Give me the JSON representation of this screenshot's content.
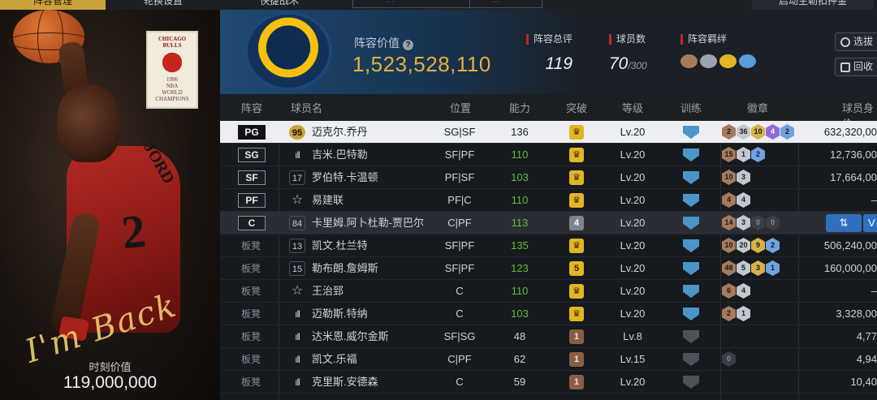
{
  "tabs": [
    {
      "label": "阵容管理",
      "active": true
    },
    {
      "label": "轮换设置"
    },
    {
      "label": "快捷战术"
    }
  ],
  "top_input": {
    "left": "…",
    "right": "…"
  },
  "top_right_button": "启动主勒扣押金",
  "card": {
    "badge_lines": [
      "CHICAGO",
      "BULLS",
      "1996",
      "NBA",
      "WORLD",
      "CHAMPIONS"
    ],
    "jersey_text": "JORD",
    "jersey_number": "2",
    "signature": "I'm Back",
    "value_label": "时刻价值",
    "value": "119,000,000"
  },
  "header": {
    "team_value_label": "阵容价值",
    "team_value": "1,523,528,110",
    "rating_label": "阵容总评",
    "rating": "119",
    "players_label": "球员数",
    "players_count": "70",
    "players_max": "/300",
    "bonds_label": "阵容羁绊",
    "bond_colors": [
      "#a8795a",
      "#9aa3b2",
      "#e2b526",
      "#5a9bd8"
    ],
    "buttons": [
      "选拔",
      "回收"
    ]
  },
  "columns": [
    "阵容",
    "球员名",
    "位置",
    "能力",
    "突破",
    "等级",
    "训练",
    "徽章",
    "球员身价"
  ],
  "rows": [
    {
      "pos": "PG",
      "starter": true,
      "jn": "95",
      "jn_type": "gold",
      "name": "迈克尔.乔丹",
      "position": "SG|SF",
      "ability": "136",
      "ability_green": false,
      "break": "crown",
      "level": "Lv.20",
      "train": "blue",
      "badges": [
        [
          "br",
          "2"
        ],
        [
          "sv",
          "36"
        ],
        [
          "gd",
          "10"
        ],
        [
          "pu",
          "4"
        ],
        [
          "bl",
          "2"
        ]
      ],
      "value": "632,320,00",
      "style": "sel"
    },
    {
      "pos": "SG",
      "starter": true,
      "jn": "ıll",
      "jn_type": "bars",
      "name": "吉米.巴特勒",
      "position": "SF|PF",
      "ability": "110",
      "ability_green": true,
      "break": "crown",
      "level": "Lv.20",
      "train": "blue",
      "badges": [
        [
          "br",
          "15"
        ],
        [
          "sv",
          "1"
        ],
        [
          "bl",
          "2"
        ]
      ],
      "value": "12,736,00"
    },
    {
      "pos": "SF",
      "starter": true,
      "jn": "17",
      "jn_type": "box",
      "name": "罗伯特.卡温顿",
      "position": "PF|SF",
      "ability": "103",
      "ability_green": true,
      "break": "crown",
      "level": "Lv.20",
      "train": "blue",
      "badges": [
        [
          "br",
          "10"
        ],
        [
          "sv",
          "3"
        ]
      ],
      "value": "17,664,00"
    },
    {
      "pos": "PF",
      "starter": true,
      "jn": "☆",
      "jn_type": "star",
      "name": "易建联",
      "position": "PF|C",
      "ability": "110",
      "ability_green": true,
      "break": "crown",
      "level": "Lv.20",
      "train": "blue",
      "badges": [
        [
          "br",
          "4"
        ],
        [
          "sv",
          "4"
        ]
      ],
      "value": "–"
    },
    {
      "pos": "C",
      "starter": true,
      "jn": "84",
      "jn_type": "box",
      "name": "卡里姆.阿卜杜勒-贾巴尔",
      "position": "C|PF",
      "ability": "113",
      "ability_green": true,
      "break": "num4",
      "break_text": "4",
      "level": "Lv.20",
      "train": "blue",
      "badges": [
        [
          "br",
          "14"
        ],
        [
          "sv",
          "3"
        ],
        [
          "dk",
          "0"
        ],
        [
          "dk",
          "0"
        ]
      ],
      "value": "",
      "style": "hl",
      "swap": true
    },
    {
      "pos": "板凳",
      "starter": false,
      "jn": "13",
      "jn_type": "box",
      "name": "凯文.杜兰特",
      "position": "SF|PF",
      "ability": "135",
      "ability_green": true,
      "break": "crown",
      "level": "Lv.20",
      "train": "blue",
      "badges": [
        [
          "br",
          "10"
        ],
        [
          "sv",
          "20"
        ],
        [
          "gd",
          "9"
        ],
        [
          "bl",
          "2"
        ]
      ],
      "value": "506,240,00"
    },
    {
      "pos": "板凳",
      "starter": false,
      "jn": "15",
      "jn_type": "box",
      "name": "勒布朗.詹姆斯",
      "position": "SF|PF",
      "ability": "123",
      "ability_green": true,
      "break": "num5",
      "break_text": "5",
      "level": "Lv.20",
      "train": "blue",
      "badges": [
        [
          "br",
          "48"
        ],
        [
          "sv",
          "5"
        ],
        [
          "gd",
          "3"
        ],
        [
          "bl",
          "1"
        ]
      ],
      "value": "160,000,00"
    },
    {
      "pos": "板凳",
      "starter": false,
      "jn": "☆",
      "jn_type": "star",
      "name": "王治郅",
      "position": "C",
      "ability": "110",
      "ability_green": true,
      "break": "crown",
      "level": "Lv.20",
      "train": "blue",
      "badges": [
        [
          "br",
          "6"
        ],
        [
          "sv",
          "4"
        ]
      ],
      "value": "–"
    },
    {
      "pos": "板凳",
      "starter": false,
      "jn": "ıll",
      "jn_type": "bars",
      "name": "迈勒斯.特纳",
      "position": "C",
      "ability": "103",
      "ability_green": true,
      "break": "crown",
      "level": "Lv.20",
      "train": "blue",
      "badges": [
        [
          "br",
          "2"
        ],
        [
          "sv",
          "1"
        ]
      ],
      "value": "3,328,00"
    },
    {
      "pos": "板凳",
      "starter": false,
      "jn": "ıll",
      "jn_type": "bars",
      "name": "达米恩.威尔金斯",
      "position": "SF|SG",
      "ability": "48",
      "ability_green": false,
      "break": "num1",
      "break_text": "1",
      "level": "Lv.8",
      "train": "grey",
      "badges": [],
      "value": "4,77"
    },
    {
      "pos": "板凳",
      "starter": false,
      "jn": "ıll",
      "jn_type": "bars",
      "name": "凯文.乐福",
      "position": "C|PF",
      "ability": "62",
      "ability_green": false,
      "break": "num1",
      "break_text": "1",
      "level": "Lv.15",
      "train": "grey",
      "badges": [
        [
          "dk",
          "0"
        ]
      ],
      "value": "4,94"
    },
    {
      "pos": "板凳",
      "starter": false,
      "jn": "ıll",
      "jn_type": "bars",
      "name": "克里斯.安德森",
      "position": "C",
      "ability": "59",
      "ability_green": false,
      "break": "num1",
      "break_text": "1",
      "level": "Lv.20",
      "train": "grey",
      "badges": [],
      "value": "10,40"
    }
  ]
}
